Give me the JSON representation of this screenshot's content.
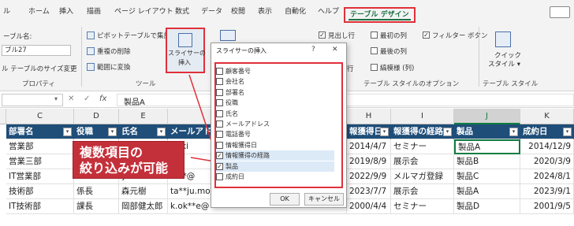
{
  "ribbon": {
    "tabs": [
      "ル",
      "ホーム",
      "挿入",
      "描画",
      "ページ レイアウト",
      "数式",
      "データ",
      "校閲",
      "表示",
      "自動化",
      "ヘルプ"
    ],
    "active_tab": "テーブル デザイン",
    "table_name_label": "ーブル名:",
    "table_name_value": "ブル27",
    "resize_label": "ル テーブルのサイズ変更",
    "pivot_label": "ピボットテーブルで集計",
    "dedupe_label": "重複の削除",
    "convert_label": "範囲に変換",
    "slicer_btn_line1": "スライサーの",
    "slicer_btn_line2": "挿入",
    "group_properties": "プロパティ",
    "group_tools": "ツール",
    "group_style_options": "テーブル スタイルのオプション",
    "group_styles": "テーブル スタイル",
    "opt_header_row": "見出し行",
    "opt_first_col": "最初の列",
    "opt_filter_button": "フィルター ボタン",
    "opt_last_col": "最後の列",
    "opt_banded_cols": "縞模様 (列)",
    "opt_row_fragment": "行",
    "quick_style_line1": "クイック",
    "quick_style_line2": "スタイル ▾",
    "paren": "( )"
  },
  "formula_bar": {
    "fx": "fx",
    "cancel": "✕",
    "enter": "✓",
    "value": "製品A"
  },
  "columns": {
    "c": "C",
    "d": "D",
    "e": "E",
    "h": "H",
    "i": "I",
    "j": "J",
    "k": "K"
  },
  "table": {
    "headers": [
      "部署名",
      "役職",
      "氏名",
      "メールアド",
      "報獲得日",
      "報獲得の経路",
      "製品",
      "成約日"
    ],
    "rows": [
      [
        "営業部",
        "",
        "",
        ":**ki",
        "2014/4/7",
        "セミナー",
        "製品A",
        "2014/12/9"
      ],
      [
        "営業三部",
        "",
        "kaha",
        "",
        "2019/8/9",
        "展示会",
        "製品B",
        "2020/3/9"
      ],
      [
        "IT営業部",
        "",
        "ya",
        "a-**@",
        "2022/9/9",
        "メルマガ登録",
        "製品C",
        "2024/8/1"
      ],
      [
        "技術部",
        "係長",
        "森元樹",
        "ta**ju.mo",
        "2023/7/7",
        "展示会",
        "製品A",
        "2023/9/1"
      ],
      [
        "IT技術部",
        "課長",
        "岡部健太郎",
        "k.ok**e@",
        "2000/4/4",
        "セミナー",
        "製品D",
        "2001/9/5"
      ]
    ]
  },
  "dialog": {
    "title": "スライサーの挿入",
    "help": "?",
    "close": "✕",
    "items": [
      {
        "label": "顧客番号",
        "checked": false
      },
      {
        "label": "会社名",
        "checked": false
      },
      {
        "label": "部署名",
        "checked": false
      },
      {
        "label": "役職",
        "checked": false
      },
      {
        "label": "氏名",
        "checked": false
      },
      {
        "label": "メールアドレス",
        "checked": false
      },
      {
        "label": "電話番号",
        "checked": false
      },
      {
        "label": "情報獲得日",
        "checked": false
      },
      {
        "label": "情報獲得の経路",
        "checked": true
      },
      {
        "label": "製品",
        "checked": true
      },
      {
        "label": "成約日",
        "checked": false
      }
    ],
    "ok": "OK",
    "cancel": "キャンセル"
  },
  "callout": {
    "line1": "複数項目の",
    "line2": "絞り込みが可能"
  },
  "colors": {
    "accent_red": "#e0303a",
    "excel_green": "#107c41",
    "table_header": "#1f4e79"
  }
}
